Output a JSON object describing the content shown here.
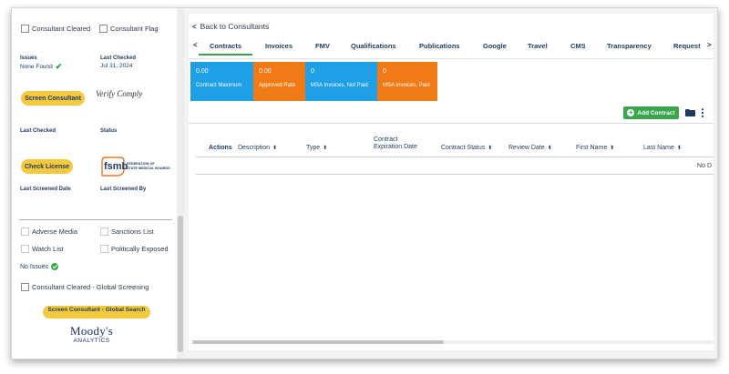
{
  "left": {
    "consultant_cleared": "Consultant Cleared",
    "consultant_flag": "Consultant Flag",
    "issues_label": "Issues",
    "issues_value": "None Found",
    "last_checked_label": "Last Checked",
    "last_checked_value": "Jul 31, 2024",
    "screen_consultant": "Screen Consultant",
    "verify_comply_logo": "Verify Comply",
    "last_checked_label2": "Last Checked",
    "status_label": "Status",
    "check_license": "Check License",
    "fsmb_logo": "fsmb",
    "fsmb_text1": "FEDERATION OF",
    "fsmb_text2": "STATE MEDICAL BOARDS",
    "last_screened_date": "Last Screened Date",
    "last_screened_by": "Last Screened By",
    "adverse_media": "Adverse Media",
    "sanctions_list": "Sanctions List",
    "watch_list": "Watch List",
    "politically_exposed": "Politically Exposed",
    "no_issues": "No Issues",
    "cleared_global": "Consultant Cleared - Global Screening",
    "screen_global": "Screen Consultant - Global Search",
    "moodys_line1": "Moody's",
    "moodys_line2": "ANALYTICS"
  },
  "main": {
    "back_link": "Back to Consultants",
    "tabs": [
      "Contracts",
      "Invoices",
      "FMV",
      "Qualifications",
      "Publications",
      "Google",
      "Travel",
      "CMS",
      "Transparency",
      "Request"
    ],
    "active_tab": "Contracts",
    "tiles": [
      {
        "value": "0.00",
        "caption": "Contract Maximum",
        "color": "#1e9fe6"
      },
      {
        "value": "0.00",
        "caption": "Approved Rate",
        "color": "#f07b16"
      },
      {
        "value": "0",
        "caption": "MSA Invoices, Not Paid",
        "color": "#1e9fe6"
      },
      {
        "value": "0",
        "caption": "MSA Invoices, Paid",
        "color": "#f07b16"
      }
    ],
    "add_contract": "Add Contract",
    "columns": {
      "actions": "Actions",
      "description": "Description",
      "type": "Type",
      "contract": "Contract",
      "expiration_date": "Expiration Date",
      "contract_status": "Contract Status",
      "review_date": "Review Date",
      "first_name": "First Name",
      "last_name": "Last Name"
    },
    "no_data": "No D"
  },
  "colors": {
    "accent_green": "#3aa54a",
    "pill_yellow": "#f5c93e",
    "tile_blue": "#1e9fe6",
    "tile_orange": "#f07b16",
    "navy": "#1e3a5f"
  }
}
